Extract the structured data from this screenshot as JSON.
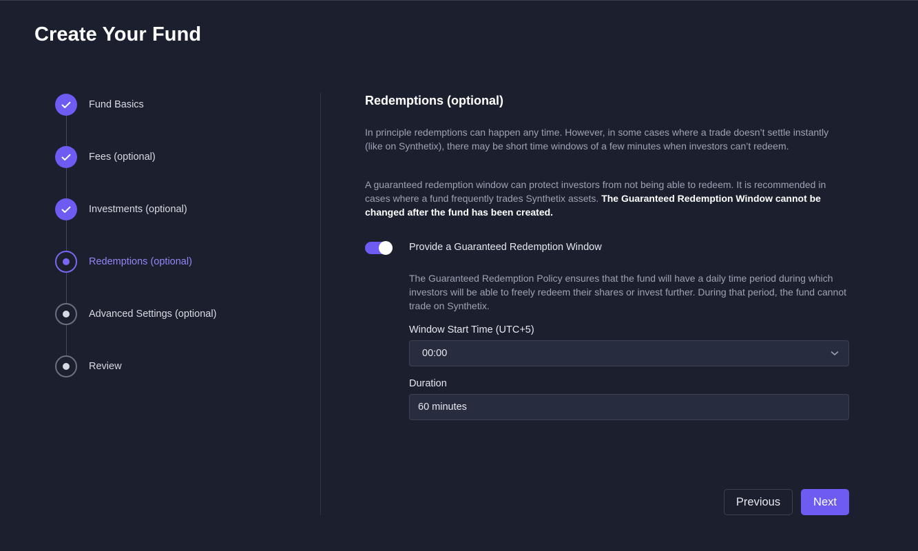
{
  "page": {
    "title": "Create Your Fund"
  },
  "stepper": {
    "steps": [
      {
        "label": "Fund Basics",
        "state": "complete",
        "icon": "check-icon"
      },
      {
        "label": "Fees (optional)",
        "state": "complete",
        "icon": "check-icon"
      },
      {
        "label": "Investments (optional)",
        "state": "complete",
        "icon": "check-icon"
      },
      {
        "label": "Redemptions (optional)",
        "state": "current",
        "icon": "dot-icon"
      },
      {
        "label": "Advanced Settings (optional)",
        "state": "upcoming",
        "icon": "dot-icon"
      },
      {
        "label": "Review",
        "state": "upcoming",
        "icon": "dot-icon"
      }
    ]
  },
  "section": {
    "title": "Redemptions (optional)",
    "intro": "In principle redemptions can happen any time. However, in some cases where a trade doesn’t settle instantly (like on Synthetix), there may be short time windows of a few minutes when investors can’t redeem.",
    "recommendation": "A guaranteed redemption window can protect investors from not being able to redeem. It is recommended in cases where a fund frequently trades Synthetix assets.",
    "warning": "The Guaranteed Redemption Window cannot be changed after the fund has been created."
  },
  "toggle": {
    "label": "Provide a Guaranteed Redemption Window",
    "checked": true
  },
  "policy": {
    "description": "The Guaranteed Redemption Policy ensures that the fund will have a daily time period during which investors will be able to freely redeem their shares or invest further. During that period, the fund cannot trade on Synthetix."
  },
  "start_time": {
    "label": "Window Start Time (UTC+5)",
    "value": "00:00"
  },
  "duration": {
    "label": "Duration",
    "value": "60 minutes"
  },
  "buttons": {
    "previous": "Previous",
    "next": "Next"
  },
  "colors": {
    "background": "#1b1f2e",
    "accent": "#6d5bf2",
    "accent_text": "#9385f7",
    "muted_text": "#9ea3b3",
    "input_bg": "#272d3e"
  }
}
